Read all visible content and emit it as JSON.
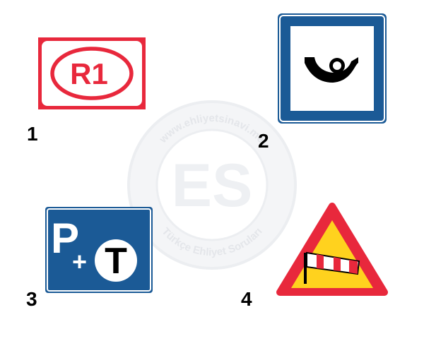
{
  "watermark": {
    "logo_text": "ES",
    "ring_top": "www.ehliyetsinavi.me",
    "ring_bottom": "Türkçe Ehliyet Soruları",
    "color": "#eceef1"
  },
  "signs": [
    {
      "number": "1",
      "icon": "route-r1-sign-icon",
      "text": "R1",
      "colors": {
        "border": "#e8283c",
        "background": "#ffffff"
      }
    },
    {
      "number": "2",
      "icon": "post-horn-sign-icon",
      "colors": {
        "border": "#1b5a96",
        "background": "#ffffff",
        "symbol": "#000000"
      }
    },
    {
      "number": "3",
      "icon": "park-and-ride-sign-icon",
      "text_p": "P",
      "text_plus": "+",
      "text_t": "T",
      "colors": {
        "background": "#1b5a96",
        "text": "#ffffff"
      }
    },
    {
      "number": "4",
      "icon": "crosswind-warning-sign-icon",
      "colors": {
        "border": "#e8283c",
        "background": "#ffd21e",
        "windsock_red": "#e8283c"
      }
    }
  ]
}
